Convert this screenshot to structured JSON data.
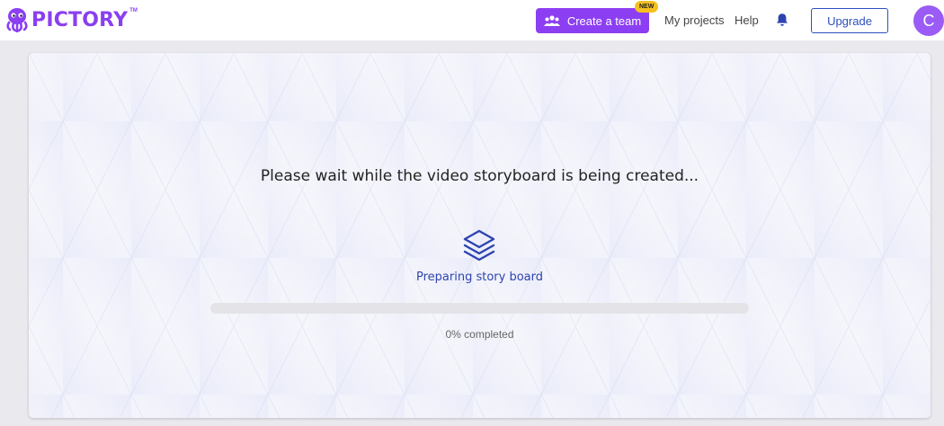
{
  "header": {
    "logo_text": "PICTORY",
    "logo_tm": "TM",
    "create_team_label": "Create a team",
    "new_badge": "NEW",
    "my_projects_label": "My projects",
    "help_label": "Help",
    "upgrade_label": "Upgrade",
    "avatar_initial": "C",
    "icons": {
      "team": "team-icon",
      "bell": "bell-icon",
      "logo": "octopus-logo-icon"
    }
  },
  "main": {
    "wait_message": "Please wait while the video storyboard is being created...",
    "status_label": "Preparing story board",
    "status_icon": "layers-icon",
    "progress_percent": 0,
    "progress_text": "0% completed"
  },
  "colors": {
    "brand_purple": "#8c3ff2",
    "accent_blue": "#2d44b0",
    "badge_yellow": "#f5c020"
  }
}
